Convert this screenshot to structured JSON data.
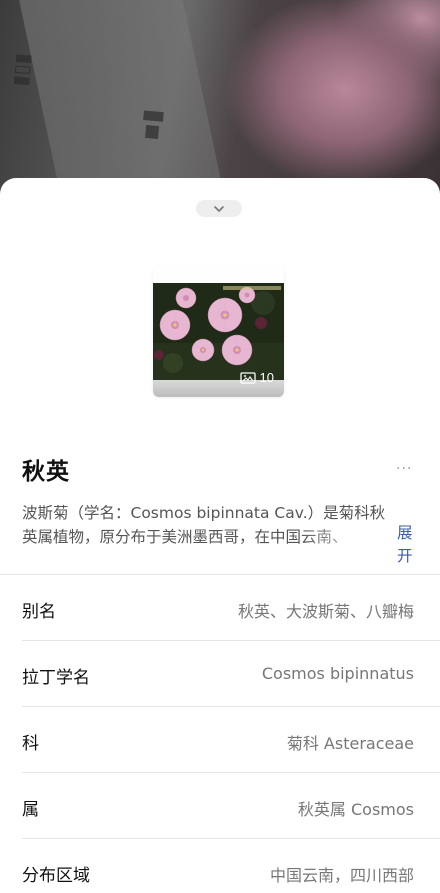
{
  "sheet": {
    "collapse_icon": "chevron-down-icon",
    "gallery": {
      "image_icon": "image-icon",
      "count": "10"
    },
    "title": "秋英",
    "more_icon": "more-dots-icon",
    "more_glyph": "···",
    "description": "波斯菊（学名：Cosmos bipinnata Cav.）是菊科秋英属植物，原分布于美洲墨西哥，在中国云南、",
    "expand_label": "展开",
    "attributes": [
      {
        "label": "别名",
        "value": "秋英、大波斯菊、八瓣梅"
      },
      {
        "label": "拉丁学名",
        "value": "Cosmos bipinnatus"
      },
      {
        "label": "科",
        "value": "菊科 Asteraceae"
      },
      {
        "label": "属",
        "value": "秋英属 Cosmos"
      },
      {
        "label": "分布区域",
        "value": "中国云南，四川西部"
      }
    ]
  },
  "colors": {
    "accent_link": "#3b5fa8",
    "title": "#111111",
    "secondary_text": "#777777"
  }
}
